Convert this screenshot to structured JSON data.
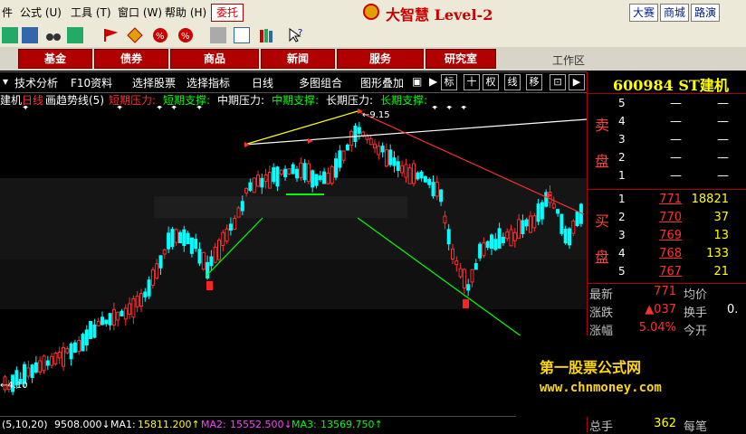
{
  "menubar": {
    "items": [
      "公式 (U)",
      "工具 (T)",
      "窗口 (W)",
      "帮助 (H)"
    ],
    "left_fragment": "件",
    "commission": "委托",
    "brand": "大智慧 Level-2",
    "right_buttons": [
      "大赛",
      "商城",
      "路演"
    ]
  },
  "nav": {
    "tabs": [
      "基金",
      "债券",
      "商品",
      "新闻",
      "服务",
      "研究室"
    ],
    "workarea": "工作区"
  },
  "chart_toolbar": {
    "items": [
      "技术分析",
      "F10资料",
      "选择股票",
      "选择指标",
      "日线",
      "多图组合",
      "图形叠加"
    ],
    "boxes": [
      "标",
      "十",
      "权",
      "线",
      "移"
    ]
  },
  "legend": {
    "stock_tail": "建机",
    "period": "日线",
    "indicator": "画趋势线(5)",
    "lines": [
      {
        "text": "短期压力:",
        "color": "#ff3030"
      },
      {
        "text": "短期支撑:",
        "color": "#00ff00"
      },
      {
        "text": "中期压力:",
        "color": "#ffffff"
      },
      {
        "text": "中期支撑:",
        "color": "#00ff00"
      },
      {
        "text": "长期压力:",
        "color": "#ffffff"
      },
      {
        "text": "长期支撑:",
        "color": "#00ff00"
      }
    ]
  },
  "chart": {
    "high_label": "9.15",
    "low_label": "4.10",
    "colors": {
      "up": "#ff3030",
      "down": "#00ffff",
      "support": "#00ff00",
      "pressure": "#ff3030",
      "long": "#ffffff",
      "mid": "#ffff00"
    }
  },
  "bottombar": {
    "param": "(5,10,20)",
    "vol": "9508.000↓",
    "ma1_label": "MA1:",
    "ma1": "15811.200↑",
    "ma2_label": "MA2:",
    "ma2": "15552.500↓",
    "ma3_label": "MA3:",
    "ma3": "13569.750↑"
  },
  "quote": {
    "code": "600984",
    "name": "ST建机",
    "sell_label": [
      "卖",
      "盘"
    ],
    "buy_label": [
      "买",
      "盘"
    ],
    "sell": [
      {
        "n": "5",
        "price": "—",
        "vol": "—"
      },
      {
        "n": "4",
        "price": "—",
        "vol": "—"
      },
      {
        "n": "3",
        "price": "—",
        "vol": "—"
      },
      {
        "n": "2",
        "price": "—",
        "vol": "—"
      },
      {
        "n": "1",
        "price": "—",
        "vol": "—"
      }
    ],
    "buy": [
      {
        "n": "1",
        "price": "771",
        "vol": "18821"
      },
      {
        "n": "2",
        "price": "770",
        "vol": "37"
      },
      {
        "n": "3",
        "price": "769",
        "vol": "13"
      },
      {
        "n": "4",
        "price": "768",
        "vol": "133"
      },
      {
        "n": "5",
        "price": "767",
        "vol": "21"
      }
    ],
    "stats": [
      {
        "l1": "最新",
        "v1": "771",
        "l2": "均价",
        "v2": ""
      },
      {
        "l1": "涨跌",
        "v1": "▲037",
        "l2": "换手",
        "v2": "0."
      },
      {
        "l1": "涨幅",
        "v1": "5.04%",
        "l2": "今开",
        "v2": ""
      }
    ],
    "bottom_fragment": [
      "总手",
      "362",
      "每笔"
    ]
  },
  "watermark": {
    "line1": "第一股票公式网",
    "line2": "www.chnmoney.com"
  }
}
